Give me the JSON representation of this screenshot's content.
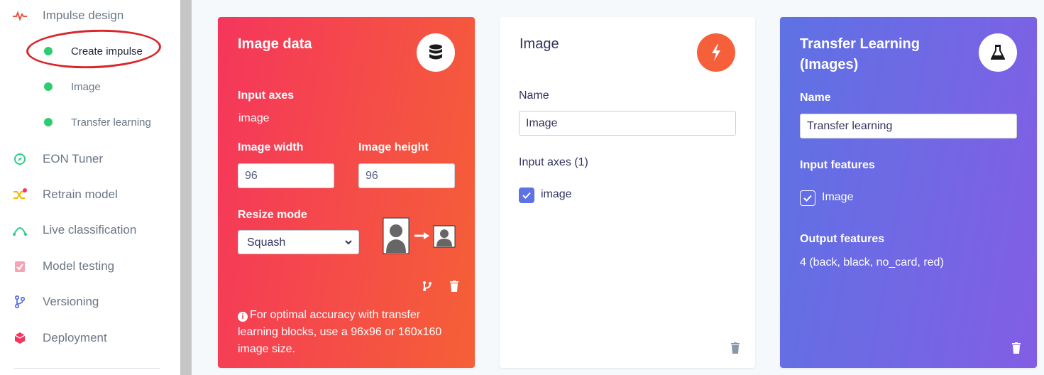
{
  "sidebar": {
    "items": [
      {
        "id": "impulse",
        "label": "Impulse design",
        "icon": "pulse-icon"
      },
      {
        "id": "eon",
        "label": "EON Tuner",
        "icon": "compass-icon"
      },
      {
        "id": "retrain",
        "label": "Retrain model",
        "icon": "shuffle-icon"
      },
      {
        "id": "live",
        "label": "Live classification",
        "icon": "curve-icon"
      },
      {
        "id": "testing",
        "label": "Model testing",
        "icon": "clipboard-check-icon"
      },
      {
        "id": "versioning",
        "label": "Versioning",
        "icon": "branch-icon"
      },
      {
        "id": "deployment",
        "label": "Deployment",
        "icon": "cube-icon"
      }
    ],
    "subitems": [
      {
        "label": "Create impulse",
        "active": true
      },
      {
        "label": "Image",
        "active": false
      },
      {
        "label": "Transfer learning",
        "active": false
      }
    ]
  },
  "cards": {
    "input": {
      "title": "Image data",
      "input_axes_label": "Input axes",
      "input_axes_value": "image",
      "width_label": "Image width",
      "width_value": "96",
      "height_label": "Image height",
      "height_value": "96",
      "resize_label": "Resize mode",
      "resize_value": "Squash",
      "note": "For optimal accuracy with transfer learning blocks, use a 96x96 or 160x160 image size."
    },
    "processing": {
      "title": "Image",
      "name_label": "Name",
      "name_value": "Image",
      "axes_label": "Input axes (1)",
      "axes_item": "image"
    },
    "learning": {
      "title_line1": "Transfer Learning",
      "title_line2": "(Images)",
      "name_label": "Name",
      "name_value": "Transfer learning",
      "features_label": "Input features",
      "features_item": "Image",
      "output_label": "Output features",
      "output_value": "4 (back, black, no_card, red)"
    }
  },
  "colors": {
    "red_start": "#f5365c",
    "red_end": "#f56036",
    "purple_start": "#5e72e4",
    "purple_end": "#825ee4",
    "dot": "#2ecc71",
    "annotation": "#d8262b"
  }
}
